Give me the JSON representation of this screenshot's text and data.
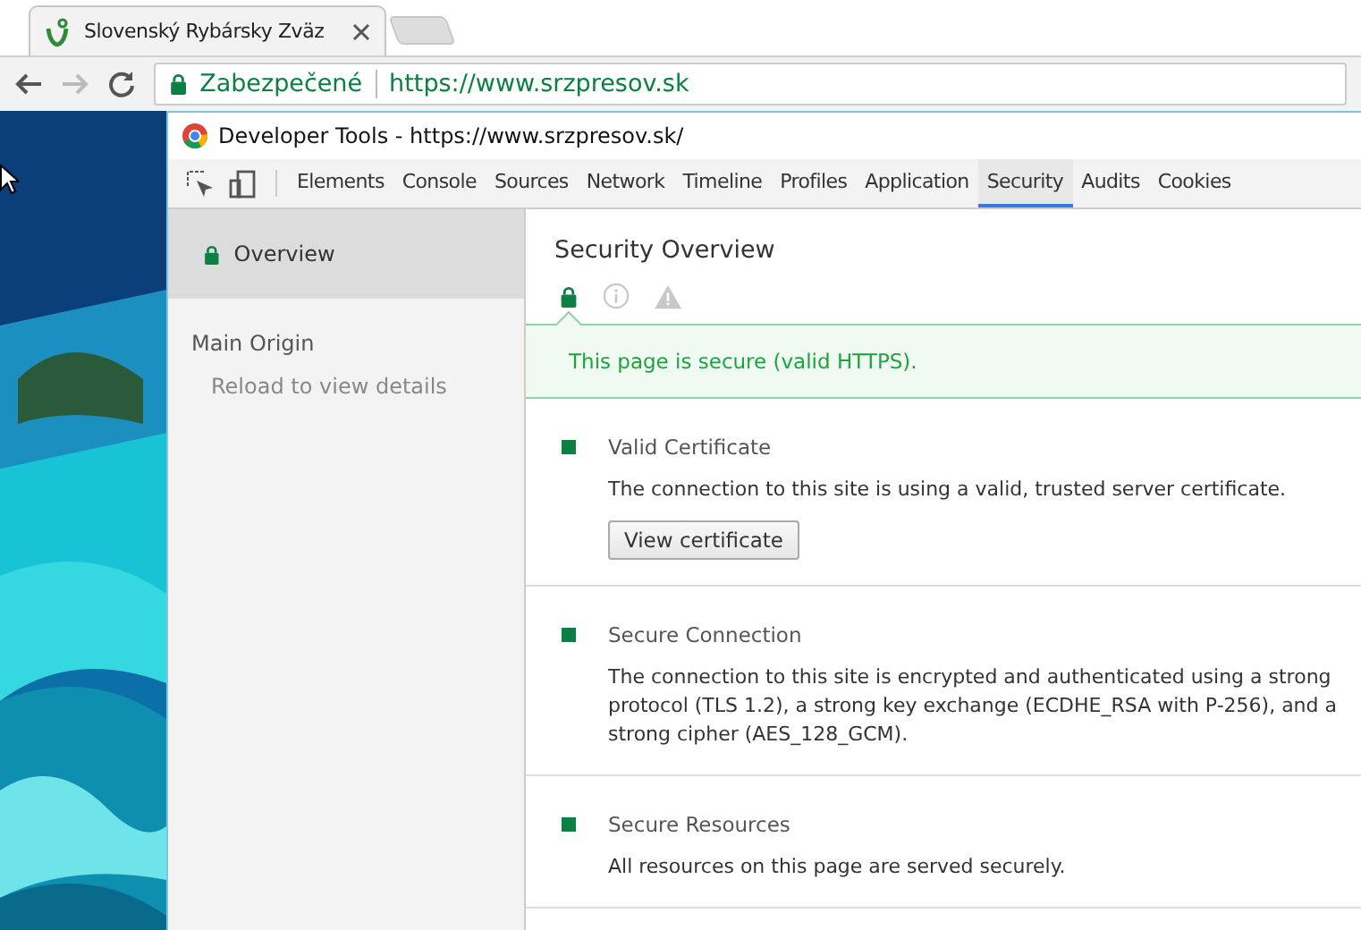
{
  "browser": {
    "tab": {
      "title": "Slovenský Rybársky Zväz"
    },
    "address": {
      "security_label": "Zabezpečené",
      "url": "https://www.srzpresov.sk"
    }
  },
  "devtools": {
    "title": "Developer Tools - https://www.srzpresov.sk/",
    "tabs": [
      {
        "label": "Elements",
        "selected": false
      },
      {
        "label": "Console",
        "selected": false
      },
      {
        "label": "Sources",
        "selected": false
      },
      {
        "label": "Network",
        "selected": false
      },
      {
        "label": "Timeline",
        "selected": false
      },
      {
        "label": "Profiles",
        "selected": false
      },
      {
        "label": "Application",
        "selected": false
      },
      {
        "label": "Security",
        "selected": true
      },
      {
        "label": "Audits",
        "selected": false
      },
      {
        "label": "Cookies",
        "selected": false
      }
    ],
    "sidebar": {
      "overview": {
        "label": "Overview",
        "selected": true
      },
      "section": "Main Origin",
      "hint": "Reload to view details"
    },
    "main": {
      "title": "Security Overview",
      "states": [
        {
          "kind": "secure",
          "selected": true
        },
        {
          "kind": "info",
          "selected": false
        },
        {
          "kind": "insecure",
          "selected": false
        }
      ],
      "summary": "This page is secure (valid HTTPS).",
      "explanations": [
        {
          "kind": "secure",
          "title": "Valid Certificate",
          "text": "The connection to this site is using a valid, trusted server certificate.",
          "button": "View certificate"
        },
        {
          "kind": "secure",
          "title": "Secure Connection",
          "text": "The connection to this site is encrypted and authenticated using a strong protocol (TLS 1.2), a strong key exchange (ECDHE_RSA with P-256), and a strong cipher (AES_128_GCM)."
        },
        {
          "kind": "secure",
          "title": "Secure Resources",
          "text": "All resources on this page are served securely."
        }
      ]
    }
  }
}
